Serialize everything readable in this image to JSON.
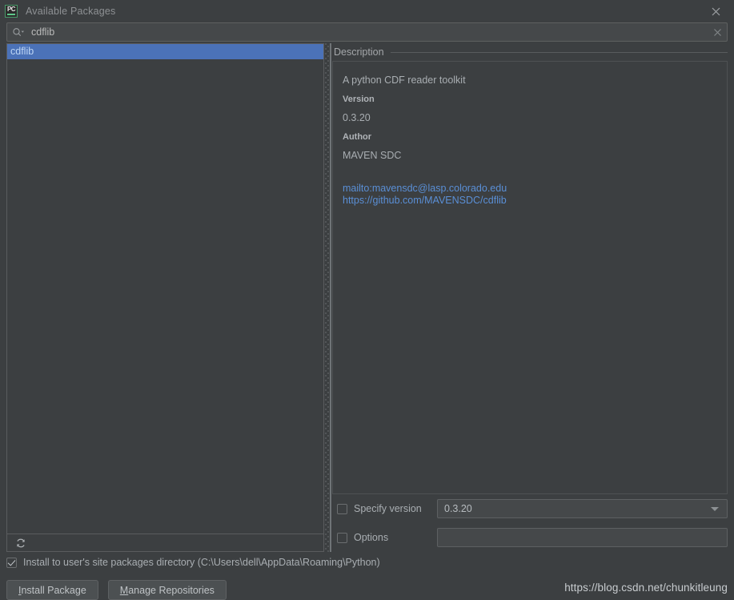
{
  "window": {
    "title": "Available Packages",
    "app_icon": "pycharm-icon",
    "close_icon": "close-icon"
  },
  "search": {
    "value": "cdflib",
    "placeholder": "",
    "icon": "search-icon",
    "clear_icon": "clear-icon"
  },
  "package_list": {
    "items": [
      {
        "name": "cdflib",
        "selected": true
      }
    ],
    "refresh_icon": "refresh-icon",
    "selection_color": "#4b72b8"
  },
  "description": {
    "section_title": "Description",
    "summary": "A python CDF reader toolkit",
    "version_label": "Version",
    "version_value": "0.3.20",
    "author_label": "Author",
    "author_value": "MAVEN SDC",
    "links": [
      "mailto:mavensdc@lasp.colorado.edu",
      "https://github.com/MAVENSDC/cdflib"
    ],
    "link_color": "#5a8fd6"
  },
  "options": {
    "specify_version_label": "Specify version",
    "specify_version_checked": false,
    "version_selected": "0.3.20",
    "options_label": "Options",
    "options_checked": false,
    "options_value": ""
  },
  "footer": {
    "user_site_label": "Install to user's site packages directory (C:\\Users\\dell\\AppData\\Roaming\\Python)",
    "user_site_checked": true,
    "install_button": {
      "pre": "",
      "mnemonic": "I",
      "post": "nstall Package"
    },
    "manage_button": {
      "pre": "",
      "mnemonic": "M",
      "post": "anage Repositories"
    },
    "watermark": "https://blog.csdn.net/chunkitleung"
  }
}
